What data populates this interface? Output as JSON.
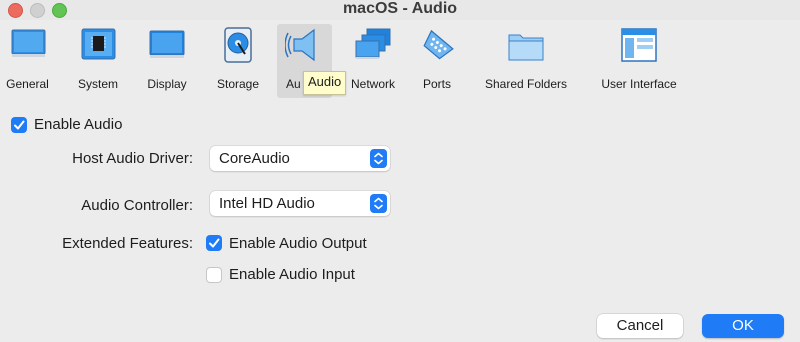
{
  "window": {
    "title": "macOS - Audio"
  },
  "toolbar": {
    "items": [
      {
        "label": "General",
        "icon": "monitor-icon"
      },
      {
        "label": "System",
        "icon": "chip-icon"
      },
      {
        "label": "Display",
        "icon": "display-icon"
      },
      {
        "label": "Storage",
        "icon": "disk-icon"
      },
      {
        "label": "Au",
        "icon": "speaker-icon",
        "selected": true
      },
      {
        "label": "Network",
        "icon": "network-icon"
      },
      {
        "label": "Ports",
        "icon": "serial-port-icon"
      },
      {
        "label": "Shared Folders",
        "icon": "folder-icon"
      },
      {
        "label": "User Interface",
        "icon": "window-icon"
      }
    ],
    "tooltip": "Audio"
  },
  "audio": {
    "enable_label": "Enable Audio",
    "enable_checked": true,
    "host_driver_label": "Host Audio Driver:",
    "host_driver_value": "CoreAudio",
    "controller_label": "Audio Controller:",
    "controller_value": "Intel HD Audio",
    "extended_label": "Extended Features:",
    "output_label": "Enable Audio Output",
    "output_checked": true,
    "input_label": "Enable Audio Input",
    "input_checked": false
  },
  "buttons": {
    "cancel": "Cancel",
    "ok": "OK"
  },
  "colors": {
    "accent": "#1f7cf6",
    "tooltip_bg": "#fffdcb"
  }
}
